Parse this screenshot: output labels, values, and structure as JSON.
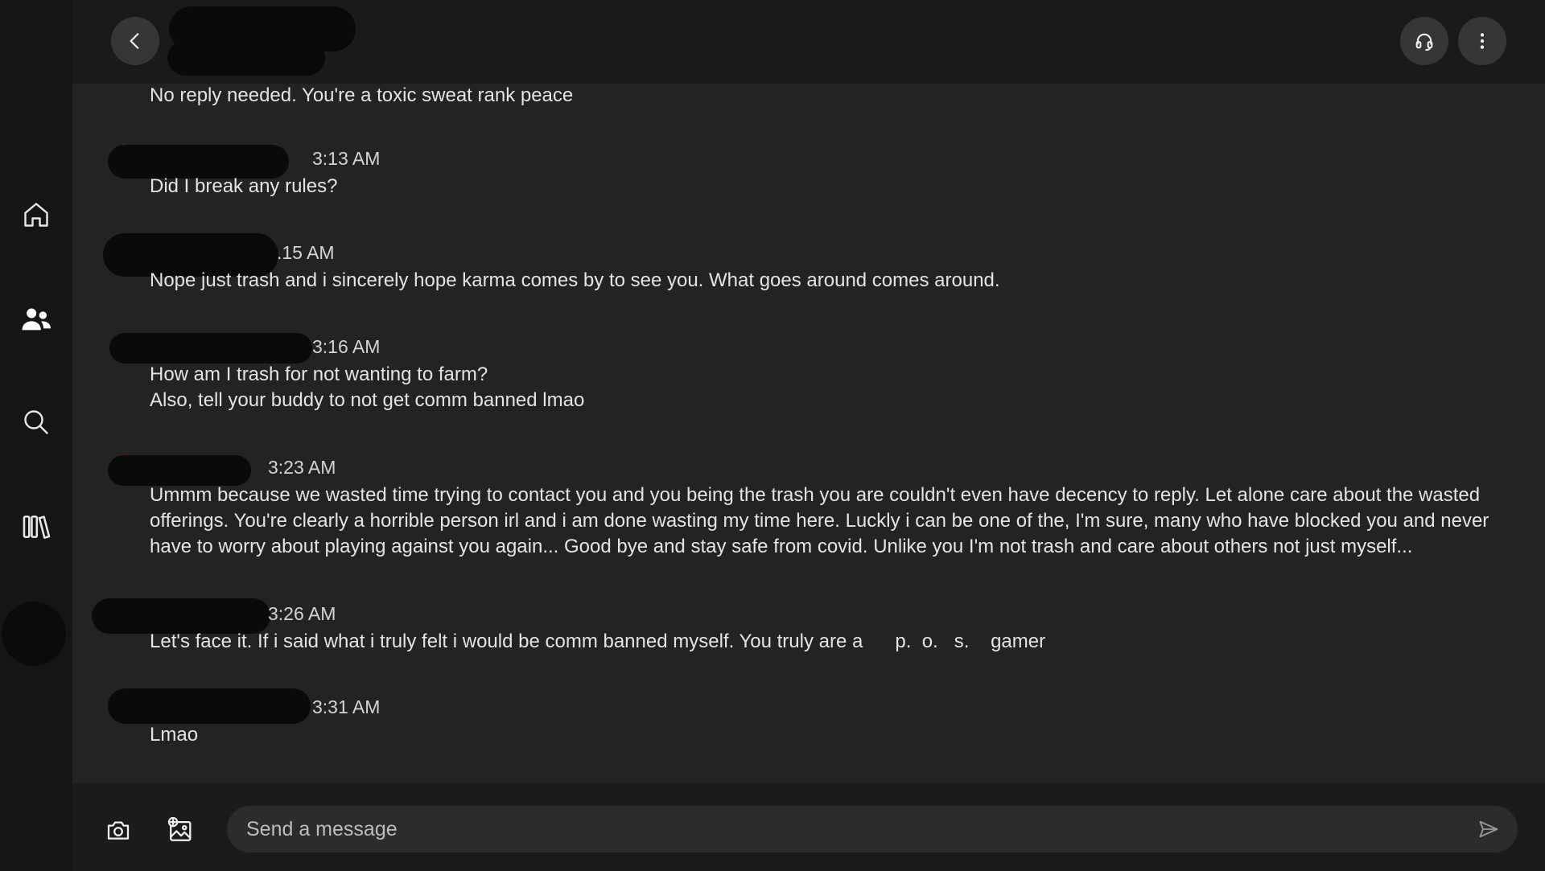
{
  "header": {
    "back_icon": "chevron-left-icon",
    "headset_icon": "headset-icon",
    "more_icon": "more-vertical-icon"
  },
  "nav": {
    "items": [
      {
        "icon": "home-icon"
      },
      {
        "icon": "friends-icon"
      },
      {
        "icon": "search-icon"
      },
      {
        "icon": "library-icon"
      }
    ]
  },
  "messages": [
    {
      "time": "",
      "lines": [
        "No reply needed. You're a toxic sweat rank peace"
      ]
    },
    {
      "time": "3:13 AM",
      "lines": [
        "Did I break any rules?"
      ]
    },
    {
      "time": ".15 AM",
      "lines": [
        "Nope just trash and i sincerely hope karma comes by to see you. What goes around comes around."
      ]
    },
    {
      "time": "3:16 AM",
      "lines": [
        "How am I trash for not wanting to farm?",
        "Also, tell your buddy to not get comm banned lmao"
      ]
    },
    {
      "time": "3:23 AM",
      "lines": [
        "Ummm because we wasted time trying to contact you and you being the trash you are couldn't even have decency to reply. Let alone care about the wasted",
        "offerings. You're clearly a horrible person irl and i am done wasting my time here. Luckly i can be one of the, I'm sure, many who have blocked you and never",
        "have to worry about playing against you again... Good bye and stay safe from covid. Unlike you I'm not trash and care about others not just myself..."
      ]
    },
    {
      "time": "3:26 AM",
      "lines": [
        "Let's face it. If i said what i truly felt i would be comm banned myself. You truly are a      p.  o.   s.    gamer"
      ]
    },
    {
      "time": "3:31 AM",
      "lines": [
        "Lmao"
      ]
    }
  ],
  "composer": {
    "placeholder": "Send a message",
    "camera_icon": "camera-icon",
    "gallery_icon": "image-add-icon",
    "send_icon": "send-icon"
  }
}
